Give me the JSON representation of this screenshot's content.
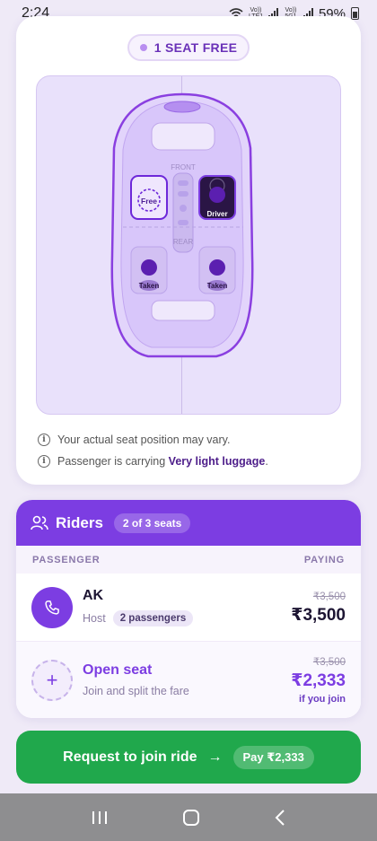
{
  "status_bar": {
    "time": "2:24",
    "network_label_1": "Vo)) LTE1",
    "network_label_2": "Vo)) 5G1",
    "battery": "59%"
  },
  "seat_card": {
    "badge": "1 SEAT FREE",
    "layout": {
      "front_label": "FRONT",
      "rear_label": "REAR",
      "seats": [
        {
          "label": "Free",
          "status": "free"
        },
        {
          "label": "Driver",
          "status": "driver"
        },
        {
          "label": "Taken",
          "status": "taken"
        },
        {
          "label": "Taken",
          "status": "taken"
        }
      ]
    },
    "notes": {
      "position_note": "Your actual seat position may vary.",
      "luggage_prefix": "Passenger is carrying ",
      "luggage_value": "Very light luggage",
      "luggage_suffix": "."
    }
  },
  "riders": {
    "title": "Riders",
    "seats_badge": "2 of 3 seats",
    "col_passenger": "PASSENGER",
    "col_paying": "PAYING",
    "host": {
      "name": "AK",
      "role": "Host",
      "passengers_badge": "2 passengers",
      "old_price": "₹3,500",
      "price": "₹3,500"
    },
    "open_seat": {
      "name": "Open seat",
      "subtitle": "Join and split the fare",
      "old_price": "₹3,500",
      "price": "₹2,333",
      "note": "if you join"
    }
  },
  "request_button": {
    "label": "Request to join ride",
    "arrow": "→",
    "pay_label": "Pay ₹2,333"
  },
  "colors": {
    "accent": "#7c3de2",
    "success": "#20a84c"
  }
}
